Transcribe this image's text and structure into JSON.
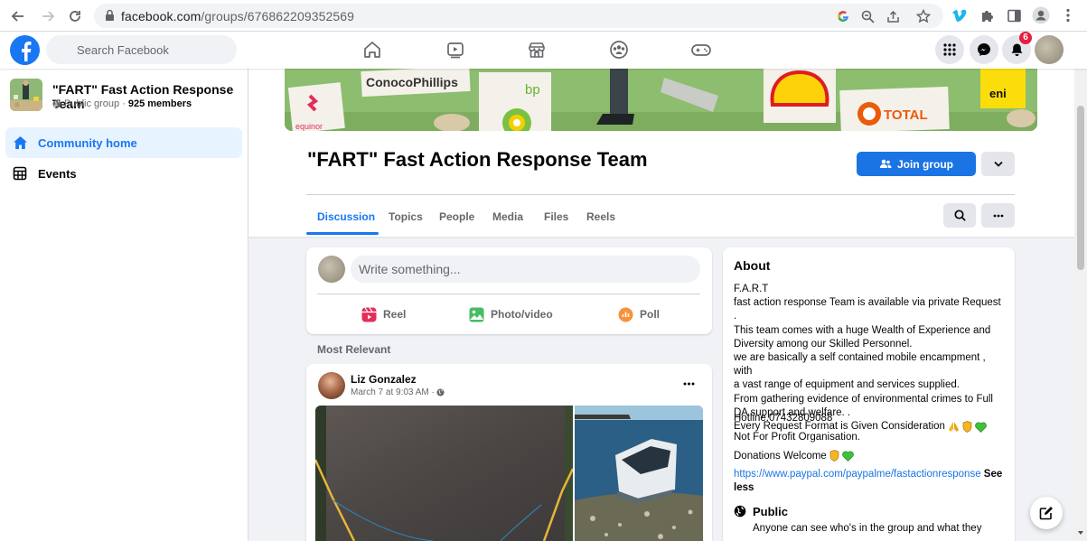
{
  "browser": {
    "url_host": "facebook.com",
    "url_path": "/groups/676862209352569"
  },
  "fb": {
    "search_placeholder": "Search Facebook",
    "notification_count": "6"
  },
  "sidebar": {
    "group_name": "\"FART\" Fast Action Response Team",
    "privacy": "Public group",
    "separator": "·",
    "members": "925 members",
    "items": [
      {
        "label": "Community home"
      },
      {
        "label": "Events"
      }
    ]
  },
  "cover": {
    "brands": [
      "ConocoPhillips",
      "bp",
      "TOTAL",
      "eni",
      "equinor"
    ]
  },
  "group": {
    "title": "\"FART\" Fast Action Response Team",
    "join_label": "Join group"
  },
  "tabs": [
    {
      "label": "Discussion"
    },
    {
      "label": "Topics"
    },
    {
      "label": "People"
    },
    {
      "label": "Media"
    },
    {
      "label": "Files"
    },
    {
      "label": "Reels"
    }
  ],
  "composer": {
    "placeholder": "Write something...",
    "actions": [
      {
        "label": "Reel"
      },
      {
        "label": "Photo/video"
      },
      {
        "label": "Poll"
      }
    ]
  },
  "feed": {
    "sort_label": "Most Relevant",
    "post": {
      "author": "Liz Gonzalez",
      "time": "March 7 at 9:03 AM ·"
    }
  },
  "about": {
    "title": "About",
    "lines": [
      "F.A.R.T",
      "fast action response Team is available via private Request .",
      "This team comes with a huge Wealth of Experience and",
      "Diversity among our Skilled Personnel.",
      "we are basically a self contained mobile encampment , with",
      "a vast range of equipment and services supplied.",
      "From gathering evidence of environmental crimes to Full",
      "DA support and welfare. .",
      "Every Request Format is Given Consideration"
    ],
    "hotline": "Hotline.07432809088",
    "nonprofit": "Not For Profit Organisation.",
    "donations": "Donations Welcome",
    "link": "https://www.paypal.com/paypalme/fastactionresponse",
    "see_less": "See less",
    "public_title": "Public",
    "public_desc": "Anyone can see who's in the group and what they"
  },
  "colors": {
    "fb_blue": "#1877f2",
    "join_blue": "#1b74e4",
    "badge_red": "#e41e3f",
    "page_bg": "#f0f2f5"
  }
}
